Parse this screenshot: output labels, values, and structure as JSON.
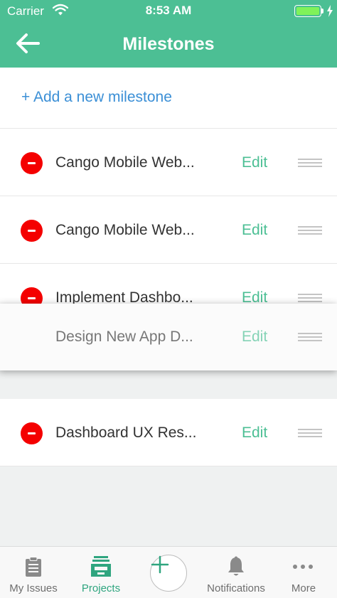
{
  "status_bar": {
    "carrier": "Carrier",
    "time": "8:53 AM",
    "battery_level": 1.0
  },
  "nav": {
    "title": "Milestones",
    "back_icon": "back-arrow-icon"
  },
  "add_milestone_label": "+ Add a new milestone",
  "edit_label": "Edit",
  "milestones": [
    {
      "title": "Cango Mobile Web..."
    },
    {
      "title": "Cango Mobile Web..."
    },
    {
      "title": "Implement Dashbo..."
    },
    {
      "title": "Dashboard UX Res..."
    }
  ],
  "dragging_item": {
    "title": "Design New App D..."
  },
  "tabs": [
    {
      "label": "My Issues",
      "icon": "clipboard-icon"
    },
    {
      "label": "Projects",
      "icon": "projects-tray-icon",
      "active": true
    },
    {
      "label": "",
      "icon": "add-icon"
    },
    {
      "label": "Notifications",
      "icon": "bell-icon"
    },
    {
      "label": "More",
      "icon": "more-dots-icon"
    }
  ],
  "colors": {
    "primary": "#4cbf94",
    "link": "#3b8fd6",
    "delete": "#f40000"
  }
}
